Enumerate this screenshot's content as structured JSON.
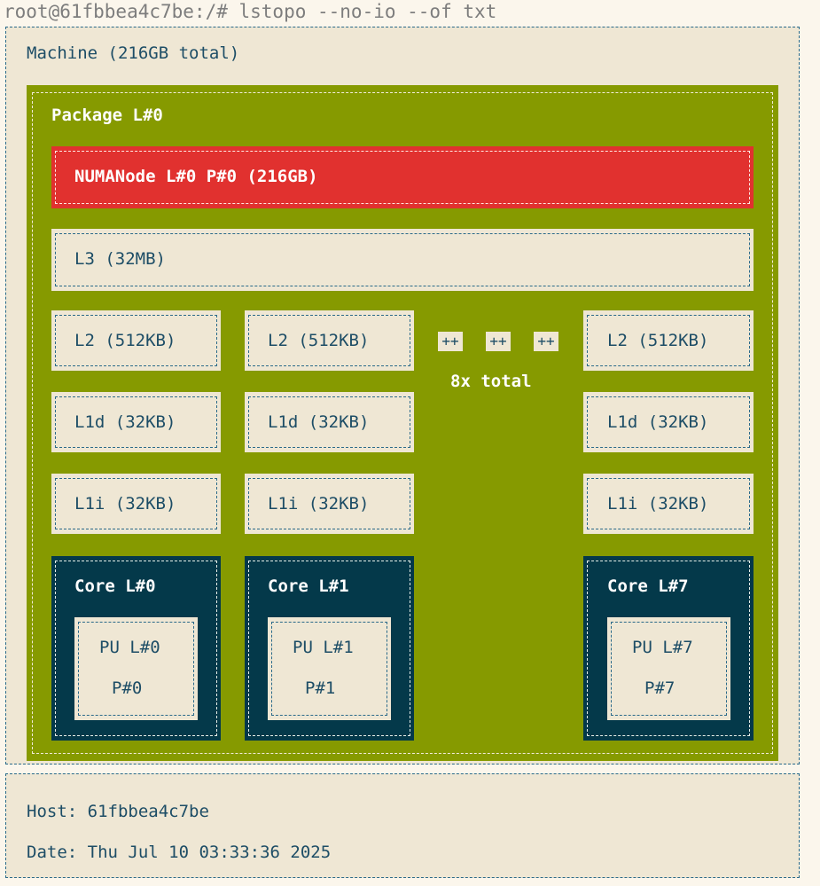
{
  "terminal": {
    "command_line": "root@61fbbea4c7be:/# lstopo --no-io --of txt"
  },
  "machine": {
    "label": "Machine (216GB total)"
  },
  "package": {
    "label": "Package L#0",
    "numa_label": "NUMANode L#0 P#0 (216GB)",
    "l3_label": "L3 (32MB)",
    "collapsed": {
      "markers": [
        "++",
        "++",
        "++"
      ],
      "total_label": "8x total"
    },
    "columns": [
      {
        "l2": "L2 (512KB)",
        "l1d": "L1d (32KB)",
        "l1i": "L1i (32KB)",
        "core": "Core L#0",
        "pu": "PU L#0",
        "pu_p": "P#0"
      },
      {
        "l2": "L2 (512KB)",
        "l1d": "L1d (32KB)",
        "l1i": "L1i (32KB)",
        "core": "Core L#1",
        "pu": "PU L#1",
        "pu_p": "P#1"
      },
      {
        "l2": "L2 (512KB)",
        "l1d": "L1d (32KB)",
        "l1i": "L1i (32KB)",
        "core": "Core L#7",
        "pu": "PU L#7",
        "pu_p": "P#7"
      }
    ]
  },
  "host": {
    "host_line": "Host: 61fbbea4c7be",
    "date_line": "Date: Thu Jul 10 03:33:36 2025"
  },
  "colors": {
    "terminal_bg": "#fbf6ec",
    "box_bg": "#efe7d4",
    "package": "#869a00",
    "numa": "#e1312f",
    "core": "#04394a",
    "text": "#1d4d66"
  }
}
